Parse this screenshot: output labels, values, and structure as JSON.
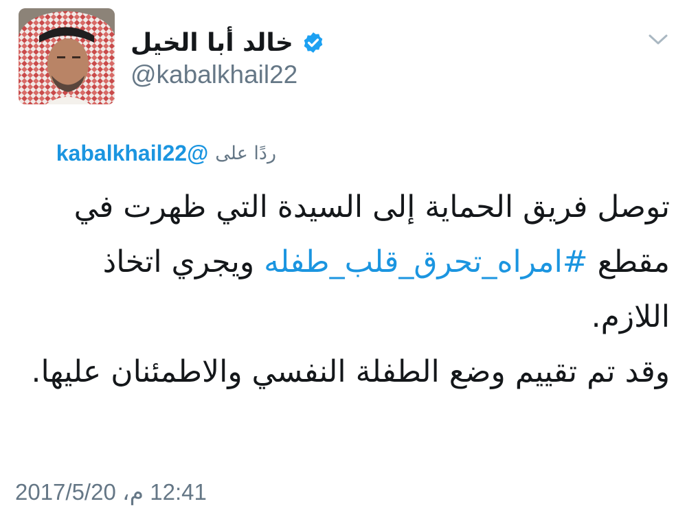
{
  "user": {
    "display_name": "خالد أبا الخيل",
    "handle": "@kabalkhail22",
    "verified": true
  },
  "reply": {
    "label": "ردًا على",
    "to_handle": "kabalkhail22@"
  },
  "body": {
    "text_before": "توصل فريق الحماية إلى السيدة التي ظهرت في مقطع ",
    "hashtag": "#امراه_تحرق_قلب_طفله",
    "text_after": "  ويجري اتخاذ اللازم.",
    "paragraph2": "وقد تم تقييم وضع الطفلة النفسي والاطمئنان عليها."
  },
  "timestamp": "12:41 م، 2017/5/20",
  "colors": {
    "link": "#1b95e0",
    "muted": "#657786",
    "text": "#14171a"
  },
  "icons": {
    "verified": "verified-badge-icon",
    "menu": "chevron-down-icon"
  }
}
